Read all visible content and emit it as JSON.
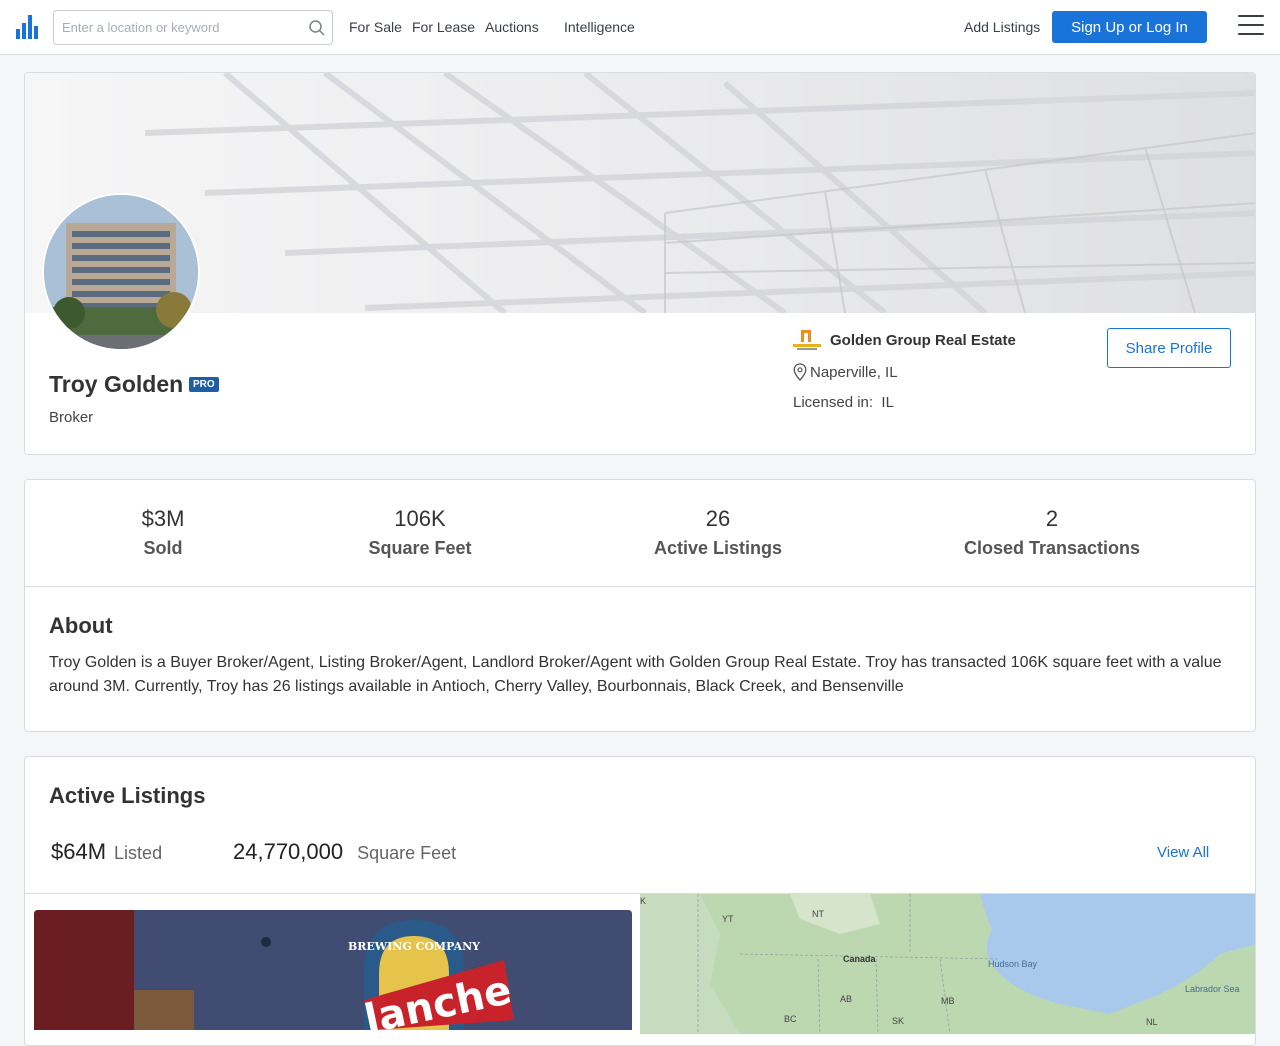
{
  "nav": {
    "search_placeholder": "Enter a location or keyword",
    "links": [
      "For Sale",
      "For Lease",
      "Auctions",
      "Intelligence"
    ],
    "add_listings": "Add Listings",
    "signup": "Sign Up or Log In",
    "accent": "#1a73d9"
  },
  "profile": {
    "name": "Troy Golden",
    "badge": "PRO",
    "role": "Broker",
    "company": "Golden Group Real Estate",
    "location": "Naperville, IL",
    "licensed_label": "Licensed in:",
    "licensed_value": "IL",
    "share": "Share Profile"
  },
  "stats": [
    {
      "value": "$3M",
      "label": "Sold"
    },
    {
      "value": "106K",
      "label": "Square Feet"
    },
    {
      "value": "26",
      "label": "Active Listings"
    },
    {
      "value": "2",
      "label": "Closed Transactions"
    }
  ],
  "about": {
    "heading": "About",
    "text": "Troy Golden is a Buyer Broker/Agent, Listing Broker/Agent, Landlord Broker/Agent with Golden Group Real Estate. Troy has transacted 106K square feet with a value around 3M. Currently, Troy has 26 listings available in Antioch, Cherry Valley, Bourbonnais, Black Creek, and Bensenville"
  },
  "listings": {
    "heading": "Active Listings",
    "listed_value": "$64M",
    "listed_label": "Listed",
    "sqft_value": "24,770,000",
    "sqft_label": "Square Feet",
    "view_all": "View All",
    "photo_sign": "BREWING COMPANY",
    "photo_text": "lanche"
  },
  "map": {
    "labels": [
      "YT",
      "NT",
      "Canada",
      "Hudson Bay",
      "Labrador Sea",
      "AB",
      "MB",
      "BC",
      "SK",
      "NL",
      "K"
    ]
  }
}
